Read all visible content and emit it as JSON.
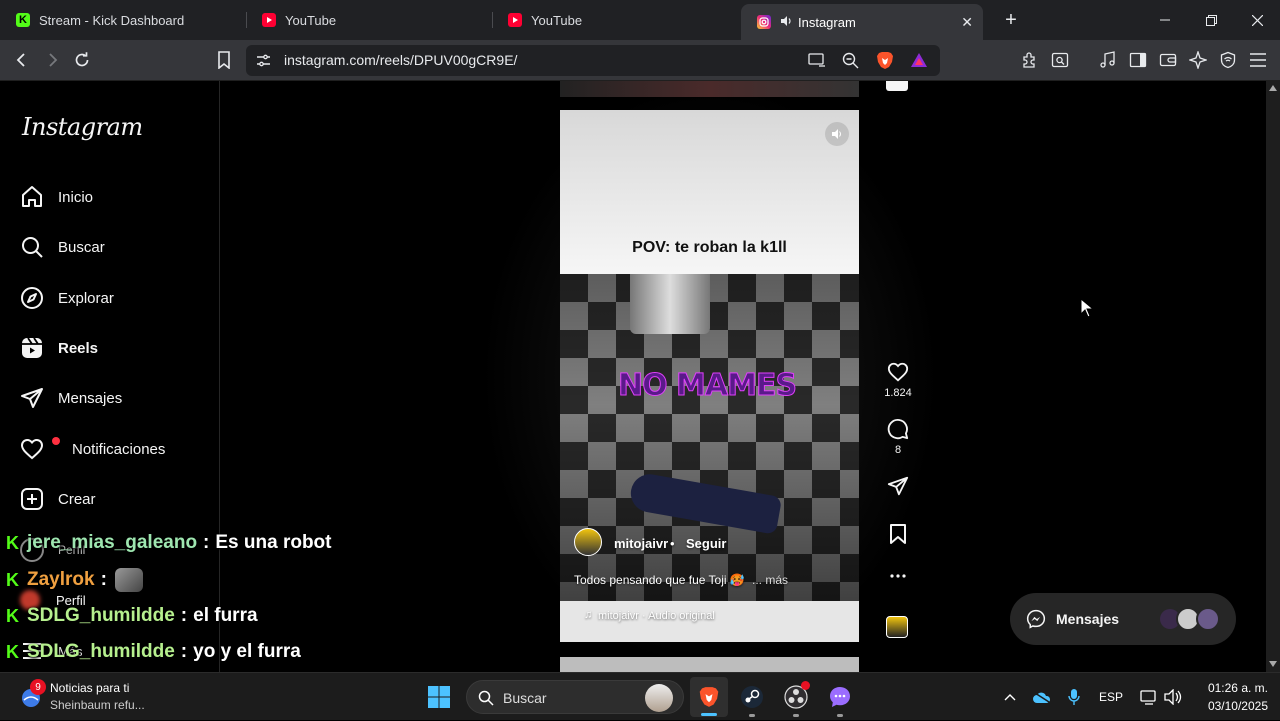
{
  "tabs": [
    {
      "title": "Stream - Kick Dashboard",
      "icon": "kick-icon"
    },
    {
      "title": "YouTube",
      "icon": "youtube-icon"
    },
    {
      "title": "YouTube",
      "icon": "youtube-icon"
    },
    {
      "title": "Instagram",
      "icon": "instagram-icon",
      "active": true
    }
  ],
  "address": {
    "url": "instagram.com/reels/DPUV00gCR9E/"
  },
  "sidebar": {
    "logo": "Instagram",
    "items": [
      {
        "label": "Inicio",
        "icon": "home-icon"
      },
      {
        "label": "Buscar",
        "icon": "search-icon"
      },
      {
        "label": "Explorar",
        "icon": "compass-icon"
      },
      {
        "label": "Reels",
        "icon": "reels-icon",
        "active": true
      },
      {
        "label": "Mensajes",
        "icon": "send-icon"
      },
      {
        "label": "Notificaciones",
        "icon": "heart-icon"
      },
      {
        "label": "Crear",
        "icon": "plus-icon"
      },
      {
        "label": "Perfil",
        "icon": "avatar-icon"
      },
      {
        "label": "Perfil"
      },
      {
        "label": "Más"
      }
    ]
  },
  "reel": {
    "caption_top": "POV: te roban la k1ll",
    "overlay_text": "NO MAMES",
    "username": "mitojaivr",
    "separator": "•",
    "follow_label": "Seguir",
    "description": "Todos pensando que fue Toji 🥵",
    "more_label": "... más",
    "audio": "mitojaivr · Audio original"
  },
  "actions": {
    "likes": "1.824",
    "comments": "8"
  },
  "messages_pill": {
    "label": "Mensajes"
  },
  "chat": [
    {
      "user": "jere_mias_galeano",
      "color": "#9ee6b0",
      "message": "Es una robot"
    },
    {
      "user": "Zaylrok",
      "color": "#f0a040",
      "message": ""
    },
    {
      "user": "SDLG_humildde",
      "color": "#b6f08e",
      "message": "el furra"
    },
    {
      "user": "SDLG_humildde",
      "color": "#b6f08e",
      "message": "yo y el furra"
    }
  ],
  "chat_colon": ":",
  "taskbar": {
    "news_title": "Noticias para ti",
    "news_sub": "Sheinbaum refu...",
    "news_badge": "9",
    "search_placeholder": "Buscar",
    "lang": "ESP",
    "time": "01:26 a. m.",
    "date": "03/10/2025"
  }
}
